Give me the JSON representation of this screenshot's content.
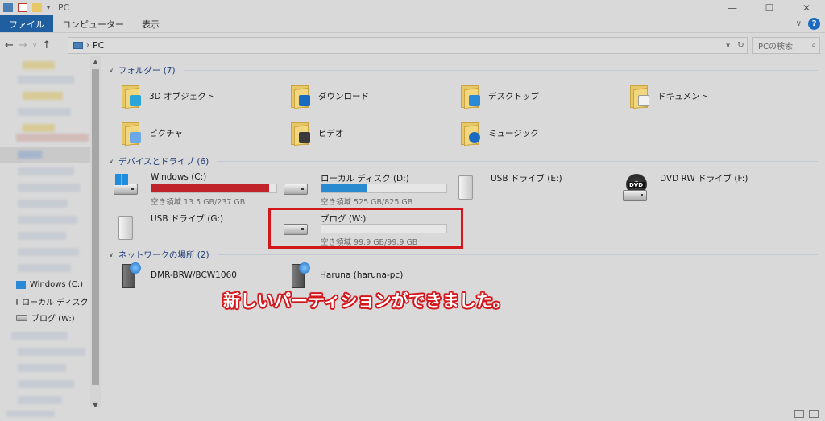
{
  "window": {
    "title": "PC",
    "controls": {
      "minimize": "—",
      "maximize": "☐",
      "close": "✕"
    }
  },
  "ribbon": {
    "tabs": [
      "ファイル",
      "コンピューター",
      "表示"
    ],
    "expand": "∨",
    "help": "?"
  },
  "address": {
    "path_root": "PC",
    "search_placeholder": "PCの検索"
  },
  "sidebar": {
    "items": [
      {
        "label": "Windows (C:)",
        "icon": "windows-drive-icon"
      },
      {
        "label": "ローカル ディスク (D",
        "icon": "drive-icon"
      },
      {
        "label": "ブログ (W:)",
        "icon": "drive-icon"
      }
    ]
  },
  "groups": {
    "folders": {
      "title": "フォルダー (7)"
    },
    "devices": {
      "title": "デバイスとドライブ (6)"
    },
    "network": {
      "title": "ネットワークの場所 (2)"
    }
  },
  "folders": [
    {
      "label": "3D オブジェクト",
      "icon": "3d-objects-folder-icon",
      "badge": "#2aa7d8"
    },
    {
      "label": "ダウンロード",
      "icon": "downloads-folder-icon",
      "badge": "#1b6ac2"
    },
    {
      "label": "デスクトップ",
      "icon": "desktop-folder-icon",
      "badge": "#2a8ad8"
    },
    {
      "label": "ドキュメント",
      "icon": "documents-folder-icon",
      "badge": "#f2f2f2"
    },
    {
      "label": "ピクチャ",
      "icon": "pictures-folder-icon",
      "badge": "#6aa8e8"
    },
    {
      "label": "ビデオ",
      "icon": "videos-folder-icon",
      "badge": "#3a3a3a"
    },
    {
      "label": "ミュージック",
      "icon": "music-folder-icon",
      "badge": "#1b6ac2"
    }
  ],
  "drives": [
    {
      "name": "Windows (C:)",
      "free": "空き領域 13.5 GB/237 GB",
      "used_fraction": 0.943,
      "bar_color": "#c1232a",
      "icon": "windows-drive-icon"
    },
    {
      "name": "ローカル ディスク (D:)",
      "free": "空き領域 525 GB/825 GB",
      "used_fraction": 0.364,
      "bar_color": "#2a8ad0",
      "icon": "hard-drive-icon"
    },
    {
      "name": "USB ドライブ (E:)",
      "icon": "usb-drive-icon"
    },
    {
      "name": "DVD RW ドライブ (F:)",
      "icon": "dvd-drive-icon",
      "dvd_label": "DVD"
    },
    {
      "name": "USB ドライブ (G:)",
      "icon": "usb-drive-icon"
    },
    {
      "name": "ブログ (W:)",
      "free": "空き領域 99.9 GB/99.9 GB",
      "used_fraction": 0.0,
      "bar_color": "#2a8ad0",
      "icon": "hard-drive-icon"
    }
  ],
  "network": [
    {
      "label": "DMR-BRW/BCW1060",
      "icon": "network-device-icon"
    },
    {
      "label": "Haruna (haruna-pc)",
      "icon": "network-pc-icon"
    }
  ],
  "annotation": {
    "text": "新しいパーティションができました。",
    "color": "#d3171d"
  }
}
